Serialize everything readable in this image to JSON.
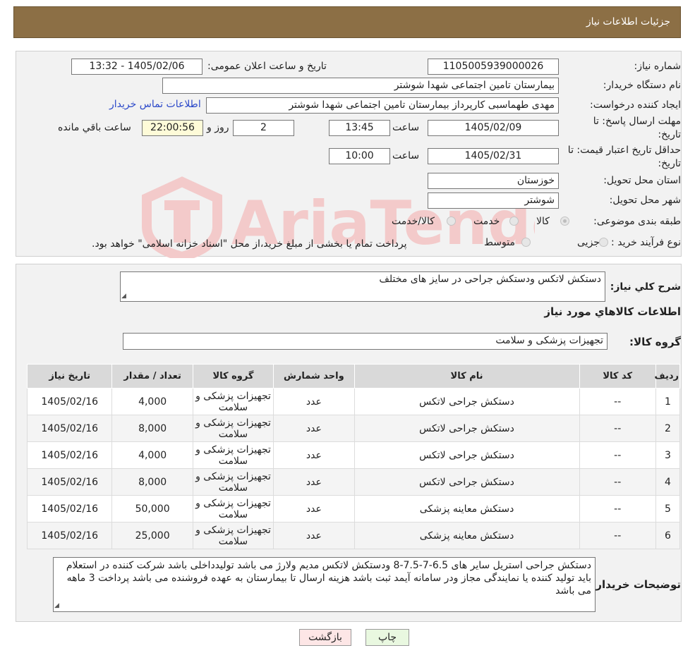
{
  "header": {
    "title": "جزئیات اطلاعات نیاز"
  },
  "form": {
    "need_number_label": "شماره نیاز:",
    "need_number": "1105005939000026",
    "announce_label": "تاریخ و ساعت اعلان عمومی:",
    "announce_value": "1405/02/06 - 13:32",
    "buyer_org_label": "نام دستگاه خریدار:",
    "buyer_org": "بیمارستان تامین اجتماعی شهدا شوشتر",
    "requester_label": "ایجاد کننده درخواست:",
    "requester": "مهدی طهماسبی کارپرداز بیمارستان تامین اجتماعی شهدا شوشتر",
    "contact_link": "اطلاعات تماس خریدار",
    "reply_deadline_label": "مهلت ارسال پاسخ: تا تاریخ:",
    "reply_date": "1405/02/09",
    "time_label": "ساعت",
    "reply_time": "13:45",
    "days_value": "2",
    "days_label": "روز و",
    "remaining_time": "22:00:56",
    "remaining_label": "ساعت باقي مانده",
    "price_validity_label": "حداقل تاریخ اعتبار قیمت: تا تاریخ:",
    "price_date": "1405/02/31",
    "price_time_label": "ساعت",
    "price_time": "10:00",
    "province_label": "استان محل تحویل:",
    "province": "خوزستان",
    "city_label": "شهر محل تحویل:",
    "city": "شوشتر",
    "category_label": "طبقه بندی موضوعی:",
    "category_options": [
      "کالا",
      "خدمت",
      "کالا/خدمت"
    ],
    "process_label": "نوع فرآیند خرید :",
    "process_options": [
      "جزیی",
      "متوسط"
    ],
    "process_note": "پرداخت تمام یا بخشی از مبلغ خرید،از محل \"اسناد خزانه اسلامی\" خواهد بود."
  },
  "section2": {
    "summary_label": "شرح کلي نیاز:",
    "summary": "دستکش لاتکس ودستکش جراحی در سایز های مختلف",
    "items_title": "اطلاعات کالاهاي مورد نیاز",
    "group_label": "گروه کالا:",
    "group_value": "تجهیزات پزشکی و سلامت"
  },
  "table": {
    "headers": [
      "ردیف",
      "کد کالا",
      "نام کالا",
      "واحد شمارش",
      "گروه کالا",
      "تعداد / مقدار",
      "تاریخ نیاز"
    ],
    "rows": [
      [
        "1",
        "--",
        "دستکش جراحی لاتکس",
        "عدد",
        "تجهیزات پزشکی و سلامت",
        "4,000",
        "1405/02/16"
      ],
      [
        "2",
        "--",
        "دستکش جراحی لاتکس",
        "عدد",
        "تجهیزات پزشکی و سلامت",
        "8,000",
        "1405/02/16"
      ],
      [
        "3",
        "--",
        "دستکش جراحی لاتکس",
        "عدد",
        "تجهیزات پزشکی و سلامت",
        "4,000",
        "1405/02/16"
      ],
      [
        "4",
        "--",
        "دستکش جراحی لاتکس",
        "عدد",
        "تجهیزات پزشکی و سلامت",
        "8,000",
        "1405/02/16"
      ],
      [
        "5",
        "--",
        "دستکش معاینه پزشکی",
        "عدد",
        "تجهیزات پزشکی و سلامت",
        "50,000",
        "1405/02/16"
      ],
      [
        "6",
        "--",
        "دستکش معاینه پزشکی",
        "عدد",
        "تجهیزات پزشکی و سلامت",
        "25,000",
        "1405/02/16"
      ]
    ]
  },
  "buyer_notes": {
    "label": "توضیحات خریدار:",
    "text": "دستکش جراحی استریل سایر های 6.5-7-7.5-8 ودستکش لاتکس مدیم ولارژ می باشد تولیدداخلی باشد شرکت کننده در استعلام باید تولید کننده یا نمایندگی مجاز ودر سامانه آیمد ثبت باشد هزینه ارسال تا بیمارستان به عهده فروشنده می باشد پرداخت 3 ماهه می باشد"
  },
  "buttons": {
    "print": "چاپ",
    "back": "بازگشت"
  },
  "watermark": {
    "text": "AriaTender.neT"
  },
  "colors": {
    "header_bg": "#8c6f45",
    "link": "#2c49c9",
    "watermark": "#f3caca"
  }
}
